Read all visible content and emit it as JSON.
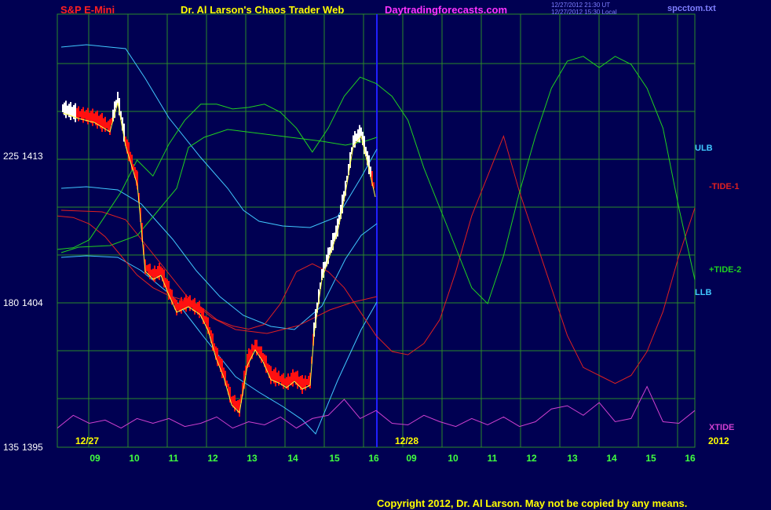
{
  "header": {
    "symbol": "S&P E-Mini",
    "title": "Dr. Al Larson's Chaos Trader Web",
    "site": "Daytradingforecasts.com",
    "time_ut": "12/27/2012 21:30 UT",
    "time_local": "12/27/2012 15:30 Local",
    "file": "spcctom.txt"
  },
  "footer": {
    "copyright": "Copyright 2012, Dr. Al Larson. May not be copied by any means."
  },
  "colors": {
    "background": "#000052",
    "grid": "#2a8a2a",
    "divider": "#2020ff",
    "title_red": "#ff2020",
    "title_yellow": "#ffff00",
    "site_magenta": "#ff33ff",
    "price": "#ff1010",
    "cyan_band": "#40c8ff",
    "ulb": "#40c8ff",
    "tide1": "#e02020",
    "tide2": "#20d020",
    "xtide": "#d040d0",
    "avg": "#ffff40"
  },
  "chart_data": {
    "type": "line",
    "title": "S&P E-Mini",
    "y_ticks": [
      {
        "left": "225",
        "right": "1413"
      },
      {
        "left": "180",
        "right": "1404"
      },
      {
        "left": "135",
        "right": "1395"
      }
    ],
    "x_ticks": [
      "09",
      "10",
      "11",
      "12",
      "13",
      "14",
      "15",
      "16",
      "09",
      "10",
      "11",
      "12",
      "13",
      "14",
      "15",
      "16"
    ],
    "date_labels": [
      "12/27",
      "12/28",
      "2012"
    ],
    "series_labels": [
      "ULB",
      "-TIDE-1",
      "+TIDE-2",
      "LLB",
      "XTIDE"
    ],
    "series": [
      {
        "name": "-TIDE-1",
        "values": [
          1409.5,
          1409.4,
          1409.0,
          1408.2,
          1407.0,
          1405.8,
          1405.0,
          1404.5,
          1404.2,
          1403.8,
          1403.0,
          1402.6,
          1402.4,
          1402.7,
          1404.0,
          1406.0,
          1406.5,
          1406.0,
          1405.0,
          1403.5,
          1402.0,
          1401.0,
          1400.8,
          1401.5,
          1403.0,
          1406.0,
          1409.5,
          1412.0,
          1414.5,
          1411.0,
          1408.0,
          1405.0,
          1402.0,
          1400.0,
          1399.5,
          1399.0,
          1399.5,
          1401.0,
          1403.5,
          1407.0,
          1410.0
        ]
      },
      {
        "name": "+TIDE-2",
        "values": [
          1407.4,
          1407.5,
          1408.0,
          1409.5,
          1411.0,
          1413.0,
          1412.0,
          1414.0,
          1415.5,
          1416.5,
          1416.5,
          1416.2,
          1416.3,
          1416.5,
          1416.0,
          1415.0,
          1413.5,
          1415.0,
          1417.0,
          1418.2,
          1417.8,
          1417.0,
          1415.5,
          1412.5,
          1410.0,
          1407.5,
          1405.0,
          1404.0,
          1407.0,
          1411.0,
          1414.5,
          1417.5,
          1419.2,
          1419.5,
          1418.8,
          1419.5,
          1419.0,
          1417.5,
          1415.0,
          1410.0,
          1405.5
        ]
      },
      {
        "name": "XTIDE",
        "values": [
          1396.2,
          1397.0,
          1396.5,
          1396.7,
          1396.2,
          1396.8,
          1396.5,
          1396.8,
          1396.3,
          1396.5,
          1396.9,
          1396.2,
          1396.6,
          1396.4,
          1396.9,
          1396.2,
          1396.8,
          1397.0,
          1398.0,
          1396.8,
          1397.3,
          1396.5,
          1396.4,
          1397.0,
          1396.6,
          1396.3,
          1396.8,
          1396.4,
          1396.9,
          1396.3,
          1396.6,
          1397.4,
          1397.6,
          1397.0,
          1397.8,
          1396.6,
          1396.8,
          1398.8,
          1396.6,
          1396.5,
          1397.3
        ]
      }
    ],
    "xlabel": "",
    "ylabel": ""
  }
}
